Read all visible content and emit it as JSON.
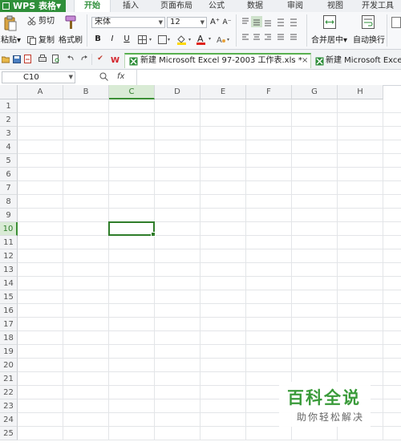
{
  "app": {
    "logo": "WPS 表格",
    "logo_caret": "▼"
  },
  "menu_tabs": [
    "开始",
    "插入",
    "页面布局",
    "公式",
    "数据",
    "审阅",
    "视图",
    "开发工具"
  ],
  "ribbon": {
    "paste_label": "粘贴",
    "paste_caret": "▾",
    "cut_label": "剪切",
    "copy_label": "复制",
    "format_painter_label": "格式刷",
    "font_name": "宋体",
    "font_size": "12",
    "grow_font": "A⁺",
    "shrink_font": "A⁻",
    "bold": "B",
    "italic": "I",
    "underline": "U",
    "merge_center_label": "合并居中",
    "merge_caret": "▾",
    "wrap_text_label": "自动换行",
    "font_color_letter": "A"
  },
  "doc_tabs": [
    {
      "label": "新建 Microsoft Excel 97-2003 工作表.xls *",
      "close": "×"
    },
    {
      "label": "新建 Microsoft Excel"
    }
  ],
  "formula_bar": {
    "cell_ref": "C10",
    "fx": "fx",
    "formula": ""
  },
  "columns": [
    "A",
    "B",
    "C",
    "D",
    "E",
    "F",
    "G",
    "H"
  ],
  "rows": [
    "1",
    "2",
    "3",
    "4",
    "5",
    "6",
    "7",
    "8",
    "9",
    "10",
    "11",
    "12",
    "13",
    "14",
    "15",
    "16",
    "17",
    "18",
    "19",
    "20",
    "21",
    "22",
    "23",
    "24",
    "25"
  ],
  "selected_cell": {
    "column": "C",
    "row": "10"
  },
  "watermark": {
    "title": "百科全说",
    "subtitle": "助你轻松解决"
  },
  "colors": {
    "accent": "#2f8f3a",
    "selection": "#2f7d2a",
    "watermark": "#3a9b3a"
  }
}
